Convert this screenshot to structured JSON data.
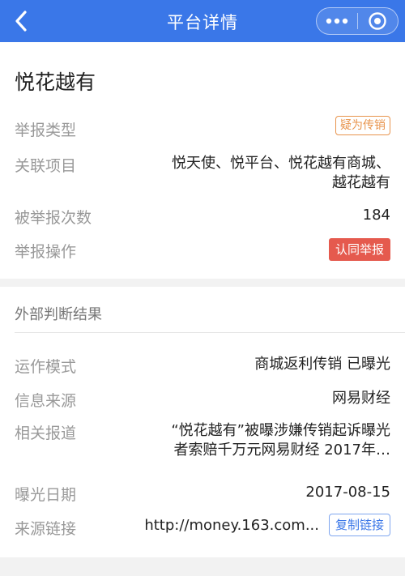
{
  "navbar": {
    "title": "平台详情",
    "back_icon": "chevron-left-icon",
    "more_icon": "more-dots-icon",
    "close_icon": "target-close-icon",
    "color": "#3a77e8"
  },
  "platform": {
    "name": "悦花越有",
    "rows": {
      "report_type": {
        "label": "举报类型",
        "badge": "疑为传销"
      },
      "related": {
        "label": "关联项目",
        "line1": "悦天使、悦平台、悦花越有商城、",
        "line2": "越花越有"
      },
      "count": {
        "label": "被举报次数",
        "value": "184"
      },
      "action": {
        "label": "举报操作",
        "button": "认同举报"
      }
    }
  },
  "external": {
    "section_title": "外部判断结果",
    "rows": {
      "mode": {
        "label": "运作模式",
        "value": "商城返利传销 已曝光"
      },
      "source": {
        "label": "信息来源",
        "value": "网易财经"
      },
      "report": {
        "label": "相关报道",
        "line1": "“悦花越有”被曝涉嫌传销起诉曝光",
        "line2": "者索赔千万元网易财经  2017年…"
      },
      "date": {
        "label": "曝光日期",
        "value": "2017-08-15"
      },
      "link": {
        "label": "来源链接",
        "value": "http://money.163.com...",
        "button": "复制链接"
      }
    }
  }
}
